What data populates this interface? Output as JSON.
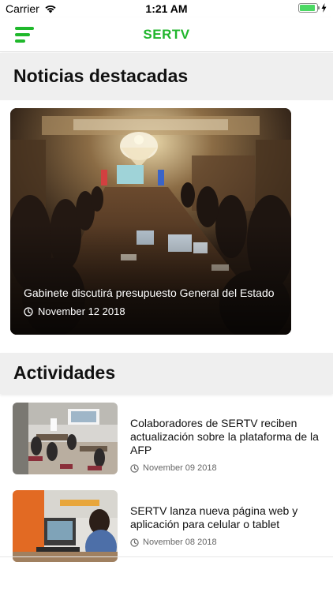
{
  "status_bar": {
    "carrier": "Carrier",
    "time": "1:21 AM",
    "battery_level": 0.9
  },
  "nav": {
    "title": "SERTV"
  },
  "sections": {
    "featured": {
      "title": "Noticias destacadas"
    },
    "activities": {
      "title": "Actividades"
    }
  },
  "featured": {
    "title": "Gabinete discutirá presupuesto General del Estado",
    "date": "November 12 2018"
  },
  "activities": [
    {
      "title": "Colaboradores de SERTV reciben actualización sobre la plataforma de la AFP",
      "date": "November 09 2018"
    },
    {
      "title": "SERTV lanza nueva  página web  y aplicación para celular o  tablet",
      "date": "November 08 2018"
    }
  ],
  "colors": {
    "brand_green": "#21b62d",
    "section_bg": "#efefef"
  },
  "icons": {
    "menu": "menu-icon",
    "clock": "clock-icon",
    "wifi": "wifi-icon",
    "battery": "battery-icon",
    "charging": "bolt-icon"
  }
}
